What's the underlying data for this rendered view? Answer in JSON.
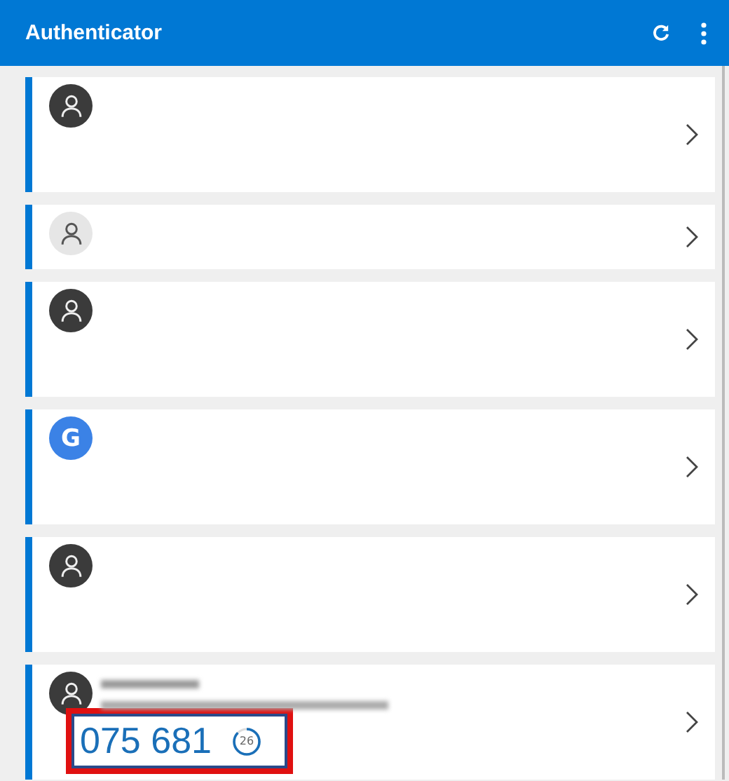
{
  "app_bar": {
    "title": "Authenticator"
  },
  "accounts": [
    {
      "avatar": {
        "kind": "person-dark"
      },
      "compact": false
    },
    {
      "avatar": {
        "kind": "person-light"
      },
      "compact": true
    },
    {
      "avatar": {
        "kind": "person-dark"
      },
      "compact": false
    },
    {
      "avatar": {
        "kind": "letter",
        "letter": "G"
      },
      "compact": false
    },
    {
      "avatar": {
        "kind": "person-dark"
      },
      "compact": false
    },
    {
      "avatar": {
        "kind": "person-dark"
      },
      "compact": false,
      "name_redacted": true,
      "code": "075 681",
      "timer": {
        "seconds": "26",
        "level": 0.87
      },
      "highlighted": true
    }
  ]
}
